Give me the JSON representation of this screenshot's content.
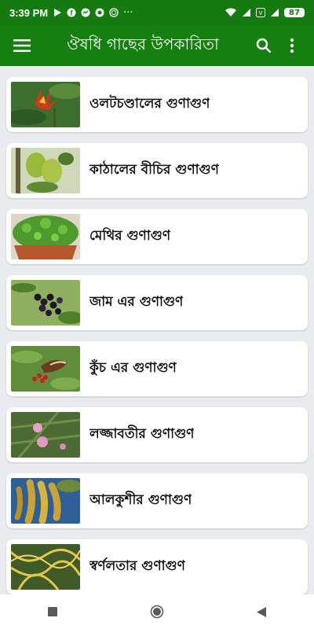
{
  "status_bar": {
    "time": "3:39 PM",
    "more": "···",
    "battery": "87",
    "left_icons": [
      "play-store-icon",
      "facebook-icon",
      "messenger-icon",
      "whatsapp-icon",
      "signal-icon"
    ],
    "right_icons": [
      "wifi-icon",
      "cellular-signal-icon",
      "volte-icon",
      "cellular-signal-icon",
      "battery-icon"
    ]
  },
  "app_bar": {
    "title": "ঔষধি গাছের উপকারিতা",
    "icons": [
      "menu-icon",
      "search-icon",
      "more-vert-icon"
    ]
  },
  "items": [
    {
      "label": "ওলটচণ্ডালের গুণাগুণ"
    },
    {
      "label": "কাঠালের বীচির গুণাগুণ"
    },
    {
      "label": "মেথির গুণাগুণ"
    },
    {
      "label": "জাম এর গুণাগুণ"
    },
    {
      "label": "কুঁচ এর গুণাগুণ"
    },
    {
      "label": "লজ্জাবতীর গুণাগুণ"
    },
    {
      "label": "আলকুশীর গুণাগুণ"
    },
    {
      "label": "স্বর্ণলতার গুণাগুণ"
    }
  ],
  "nav_bar": {
    "icons": [
      "recents-icon",
      "home-icon",
      "back-icon"
    ]
  },
  "colors": {
    "app_bar": "#15800f",
    "status_bar": "#157a10",
    "background": "#e9ebee"
  }
}
